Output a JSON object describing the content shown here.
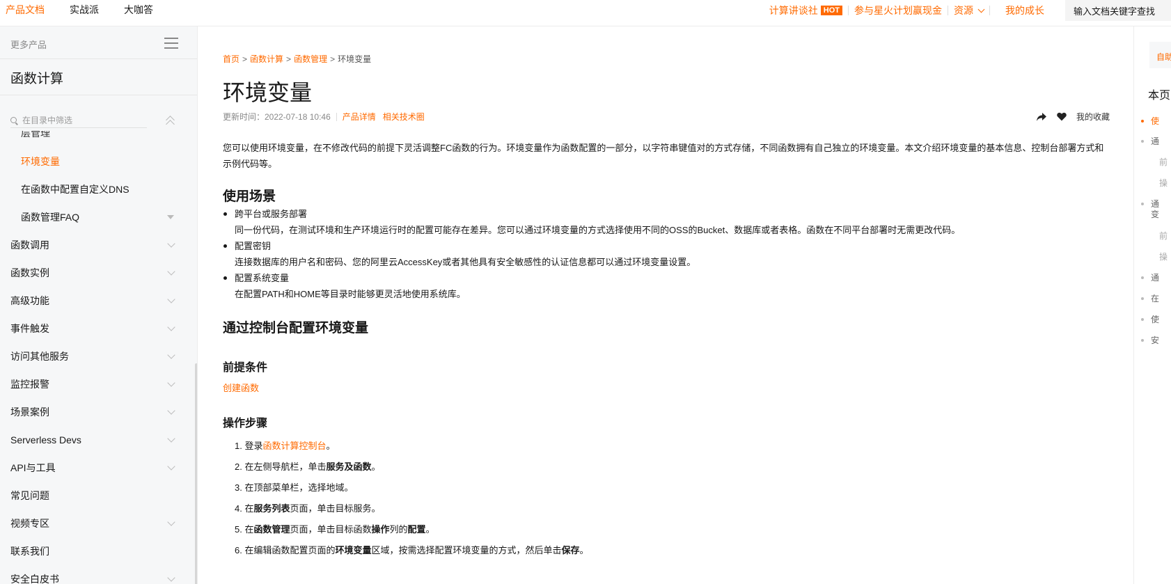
{
  "topbar": {
    "nav": [
      "产品文档",
      "实战派",
      "大咖答"
    ],
    "right": {
      "talk": "计算讲谈社",
      "hot": "HOT",
      "spark": "参与星火计划赢现金",
      "resources": "资源",
      "growth": "我的成长",
      "search_placeholder": "输入文档关键字查找"
    }
  },
  "sidebar": {
    "more_products": "更多产品",
    "product_title": "函数计算",
    "filter_placeholder": "在目录中筛选",
    "partial_item": "层管理",
    "items": [
      {
        "label": "环境变量",
        "sub": true,
        "active": true
      },
      {
        "label": "在函数中配置自定义DNS",
        "sub": true
      },
      {
        "label": "函数管理FAQ",
        "sub": true
      },
      {
        "label": "函数调用"
      },
      {
        "label": "函数实例"
      },
      {
        "label": "高级功能"
      },
      {
        "label": "事件触发"
      },
      {
        "label": "访问其他服务"
      },
      {
        "label": "监控报警"
      },
      {
        "label": "场景案例"
      },
      {
        "label": "Serverless Devs"
      },
      {
        "label": "API与工具"
      },
      {
        "label": "常见问题"
      },
      {
        "label": "视频专区"
      },
      {
        "label": "联系我们"
      },
      {
        "label": "安全白皮书"
      }
    ]
  },
  "breadcrumb": [
    "首页",
    "函数计算",
    "函数管理",
    "环境变量"
  ],
  "page": {
    "title": "环境变量",
    "updated": "更新时间：2022-07-18 10:46",
    "product_detail": "产品详情",
    "tech_circle": "相关技术圈",
    "favorite": "我的收藏",
    "intro": "您可以使用环境变量，在不修改代码的前提下灵活调整FC函数的行为。环境变量作为函数配置的一部分，以字符串键值对的方式存储，不同函数拥有自己独立的环境变量。本文介绍环境变量的基本信息、控制台部署方式和示例代码等。",
    "sec_usage": "使用场景",
    "scenes": [
      {
        "title": "跨平台或服务部署",
        "desc": "同一份代码，在测试环境和生产环境运行时的配置可能存在差异。您可以通过环境变量的方式选择使用不同的OSS的Bucket、数据库或者表格。函数在不同平台部署时无需更改代码。"
      },
      {
        "title": "配置密钥",
        "desc": "连接数据库的用户名和密码、您的阿里云AccessKey或者其他具有安全敏感性的认证信息都可以通过环境变量设置。"
      },
      {
        "title": "配置系统变量",
        "desc": "在配置PATH和HOME等目录时能够更灵活地使用系统库。"
      }
    ],
    "sec_console": "通过控制台配置环境变量",
    "prereq_title": "前提条件",
    "prereq_link": "创建函数",
    "steps_title": "操作步骤",
    "steps": {
      "s1_pre": "1. 登录",
      "s1_link": "函数计算控制台",
      "s1_post": "。",
      "s2_pre": "2. 在左侧导航栏，单击",
      "s2_b": "服务及函数",
      "s2_post": "。",
      "s3": "3. 在顶部菜单栏，选择地域。",
      "s4_pre": "4. 在",
      "s4_b": "服务列表",
      "s4_post": "页面，单击目标服务。",
      "s5_pre": "5. 在",
      "s5_b": "函数管理",
      "s5_mid": "页面，单击目标函数",
      "s5_b2": "操作",
      "s5_mid2": "列的",
      "s5_b3": "配置",
      "s5_post": "。",
      "s6_pre": "6. 在编辑函数配置页面的",
      "s6_b": "环境变量",
      "s6_mid": "区域，按需选择配置环境变量的方式，然后单击",
      "s6_b2": "保存",
      "s6_post": "。"
    }
  },
  "toc": {
    "self_btn": "自助",
    "title": "本页",
    "items": [
      "使",
      "通",
      "前",
      "操",
      "通变",
      "前",
      "操",
      "通",
      "在",
      "使",
      "安"
    ]
  }
}
